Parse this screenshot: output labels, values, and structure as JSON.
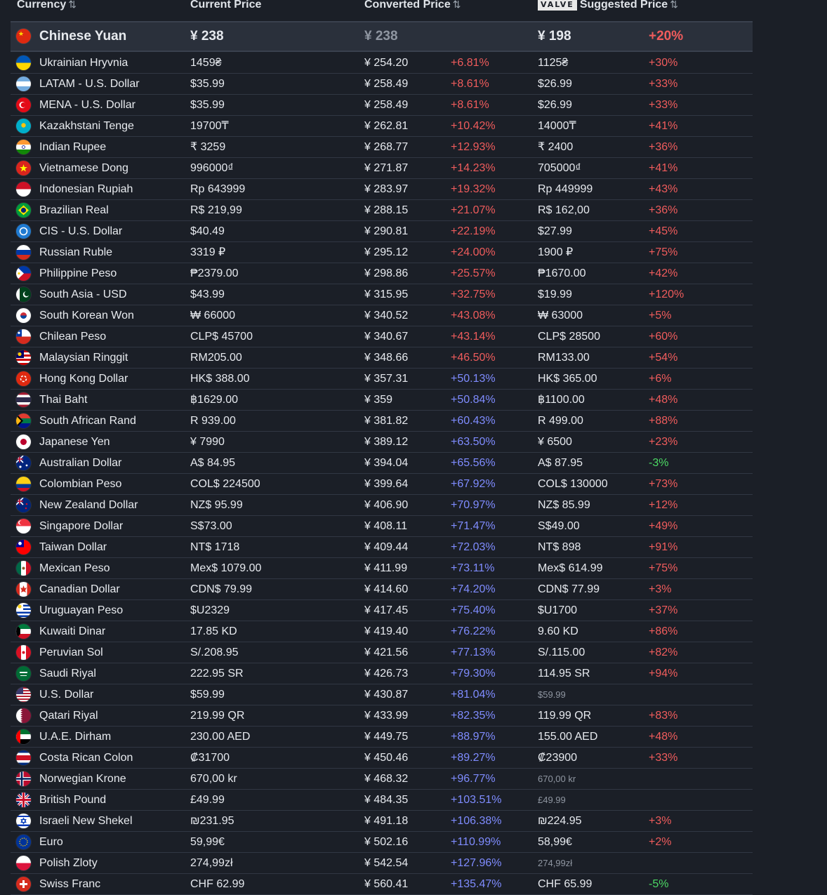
{
  "header": {
    "currency": "Currency",
    "current_price": "Current Price",
    "converted_price": "Converted Price",
    "valve_logo": "VALVE",
    "suggested_price": "Suggested Price",
    "sort_icon": "⇅"
  },
  "pinned": {
    "name": "Chinese Yuan",
    "current": "¥ 238",
    "converted": "¥ 238",
    "suggested": "¥ 198",
    "suggested_pct": "+20%",
    "flag_icon": "china-flag-icon"
  },
  "colors": {
    "background": "#1b1f27",
    "pinned_background": "#2a303b",
    "red": "#f05c5c",
    "blue": "#7f8cff",
    "green": "#4cd964",
    "muted": "#8f96a1"
  },
  "rows": [
    {
      "name": "Ukrainian Hryvnia",
      "current": "1459₴",
      "converted": "¥ 254.20",
      "pct": "+6.81%",
      "suggested": "1125₴",
      "spct": "+30%"
    },
    {
      "name": "LATAM - U.S. Dollar",
      "current": "$35.99",
      "converted": "¥ 258.49",
      "pct": "+8.61%",
      "suggested": "$26.99",
      "spct": "+33%"
    },
    {
      "name": "MENA - U.S. Dollar",
      "current": "$35.99",
      "converted": "¥ 258.49",
      "pct": "+8.61%",
      "suggested": "$26.99",
      "spct": "+33%"
    },
    {
      "name": "Kazakhstani Tenge",
      "current": "19700₸",
      "converted": "¥ 262.81",
      "pct": "+10.42%",
      "suggested": "14000₸",
      "spct": "+41%"
    },
    {
      "name": "Indian Rupee",
      "current": "₹ 3259",
      "converted": "¥ 268.77",
      "pct": "+12.93%",
      "suggested": "₹ 2400",
      "spct": "+36%"
    },
    {
      "name": "Vietnamese Dong",
      "current": "996000₫",
      "converted": "¥ 271.87",
      "pct": "+14.23%",
      "suggested": "705000₫",
      "spct": "+41%"
    },
    {
      "name": "Indonesian Rupiah",
      "current": "Rp 643999",
      "converted": "¥ 283.97",
      "pct": "+19.32%",
      "suggested": "Rp 449999",
      "spct": "+43%"
    },
    {
      "name": "Brazilian Real",
      "current": "R$ 219,99",
      "converted": "¥ 288.15",
      "pct": "+21.07%",
      "suggested": "R$ 162,00",
      "spct": "+36%"
    },
    {
      "name": "CIS - U.S. Dollar",
      "current": "$40.49",
      "converted": "¥ 290.81",
      "pct": "+22.19%",
      "suggested": "$27.99",
      "spct": "+45%"
    },
    {
      "name": "Russian Ruble",
      "current": "3319 ₽",
      "converted": "¥ 295.12",
      "pct": "+24.00%",
      "suggested": "1900 ₽",
      "spct": "+75%"
    },
    {
      "name": "Philippine Peso",
      "current": "₱2379.00",
      "converted": "¥ 298.86",
      "pct": "+25.57%",
      "suggested": "₱1670.00",
      "spct": "+42%"
    },
    {
      "name": "South Asia - USD",
      "current": "$43.99",
      "converted": "¥ 315.95",
      "pct": "+32.75%",
      "suggested": "$19.99",
      "spct": "+120%"
    },
    {
      "name": "South Korean Won",
      "current": "₩ 66000",
      "converted": "¥ 340.52",
      "pct": "+43.08%",
      "suggested": "₩ 63000",
      "spct": "+5%"
    },
    {
      "name": "Chilean Peso",
      "current": "CLP$ 45700",
      "converted": "¥ 340.67",
      "pct": "+43.14%",
      "suggested": "CLP$ 28500",
      "spct": "+60%"
    },
    {
      "name": "Malaysian Ringgit",
      "current": "RM205.00",
      "converted": "¥ 348.66",
      "pct": "+46.50%",
      "suggested": "RM133.00",
      "spct": "+54%"
    },
    {
      "name": "Hong Kong Dollar",
      "current": "HK$ 388.00",
      "converted": "¥ 357.31",
      "pct": "+50.13%",
      "suggested": "HK$ 365.00",
      "spct": "+6%"
    },
    {
      "name": "Thai Baht",
      "current": "฿1629.00",
      "converted": "¥ 359",
      "pct": "+50.84%",
      "suggested": "฿1100.00",
      "spct": "+48%"
    },
    {
      "name": "South African Rand",
      "current": "R 939.00",
      "converted": "¥ 381.82",
      "pct": "+60.43%",
      "suggested": "R 499.00",
      "spct": "+88%"
    },
    {
      "name": "Japanese Yen",
      "current": "¥ 7990",
      "converted": "¥ 389.12",
      "pct": "+63.50%",
      "suggested": "¥ 6500",
      "spct": "+23%"
    },
    {
      "name": "Australian Dollar",
      "current": "A$ 84.95",
      "converted": "¥ 394.04",
      "pct": "+65.56%",
      "suggested": "A$ 87.95",
      "spct": "-3%"
    },
    {
      "name": "Colombian Peso",
      "current": "COL$ 224500",
      "converted": "¥ 399.64",
      "pct": "+67.92%",
      "suggested": "COL$ 130000",
      "spct": "+73%"
    },
    {
      "name": "New Zealand Dollar",
      "current": "NZ$ 95.99",
      "converted": "¥ 406.90",
      "pct": "+70.97%",
      "suggested": "NZ$ 85.99",
      "spct": "+12%"
    },
    {
      "name": "Singapore Dollar",
      "current": "S$73.00",
      "converted": "¥ 408.11",
      "pct": "+71.47%",
      "suggested": "S$49.00",
      "spct": "+49%"
    },
    {
      "name": "Taiwan Dollar",
      "current": "NT$ 1718",
      "converted": "¥ 409.44",
      "pct": "+72.03%",
      "suggested": "NT$ 898",
      "spct": "+91%"
    },
    {
      "name": "Mexican Peso",
      "current": "Mex$ 1079.00",
      "converted": "¥ 411.99",
      "pct": "+73.11%",
      "suggested": "Mex$ 614.99",
      "spct": "+75%"
    },
    {
      "name": "Canadian Dollar",
      "current": "CDN$ 79.99",
      "converted": "¥ 414.60",
      "pct": "+74.20%",
      "suggested": "CDN$ 77.99",
      "spct": "+3%"
    },
    {
      "name": "Uruguayan Peso",
      "current": "$U2329",
      "converted": "¥ 417.45",
      "pct": "+75.40%",
      "suggested": "$U1700",
      "spct": "+37%"
    },
    {
      "name": "Kuwaiti Dinar",
      "current": "17.85 KD",
      "converted": "¥ 419.40",
      "pct": "+76.22%",
      "suggested": "9.60 KD",
      "spct": "+86%"
    },
    {
      "name": "Peruvian Sol",
      "current": "S/.208.95",
      "converted": "¥ 421.56",
      "pct": "+77.13%",
      "suggested": "S/.115.00",
      "spct": "+82%"
    },
    {
      "name": "Saudi Riyal",
      "current": "222.95 SR",
      "converted": "¥ 426.73",
      "pct": "+79.30%",
      "suggested": "114.95 SR",
      "spct": "+94%"
    },
    {
      "name": "U.S. Dollar",
      "current": "$59.99",
      "converted": "¥ 430.87",
      "pct": "+81.04%",
      "suggested": "$59.99",
      "spct": "",
      "muted": true
    },
    {
      "name": "Qatari Riyal",
      "current": "219.99 QR",
      "converted": "¥ 433.99",
      "pct": "+82.35%",
      "suggested": "119.99 QR",
      "spct": "+83%"
    },
    {
      "name": "U.A.E. Dirham",
      "current": "230.00 AED",
      "converted": "¥ 449.75",
      "pct": "+88.97%",
      "suggested": "155.00 AED",
      "spct": "+48%"
    },
    {
      "name": "Costa Rican Colon",
      "current": "₡31700",
      "converted": "¥ 450.46",
      "pct": "+89.27%",
      "suggested": "₡23900",
      "spct": "+33%"
    },
    {
      "name": "Norwegian Krone",
      "current": "670,00 kr",
      "converted": "¥ 468.32",
      "pct": "+96.77%",
      "suggested": "670,00 kr",
      "spct": "",
      "muted": true
    },
    {
      "name": "British Pound",
      "current": "£49.99",
      "converted": "¥ 484.35",
      "pct": "+103.51%",
      "suggested": "£49.99",
      "spct": "",
      "muted": true
    },
    {
      "name": "Israeli New Shekel",
      "current": "₪231.95",
      "converted": "¥ 491.18",
      "pct": "+106.38%",
      "suggested": "₪224.95",
      "spct": "+3%"
    },
    {
      "name": "Euro",
      "current": "59,99€",
      "converted": "¥ 502.16",
      "pct": "+110.99%",
      "suggested": "58,99€",
      "spct": "+2%"
    },
    {
      "name": "Polish Zloty",
      "current": "274,99zł",
      "converted": "¥ 542.54",
      "pct": "+127.96%",
      "suggested": "274,99zł",
      "spct": "",
      "muted": true
    },
    {
      "name": "Swiss Franc",
      "current": "CHF 62.99",
      "converted": "¥ 560.41",
      "pct": "+135.47%",
      "suggested": "CHF 65.99",
      "spct": "-5%"
    }
  ]
}
